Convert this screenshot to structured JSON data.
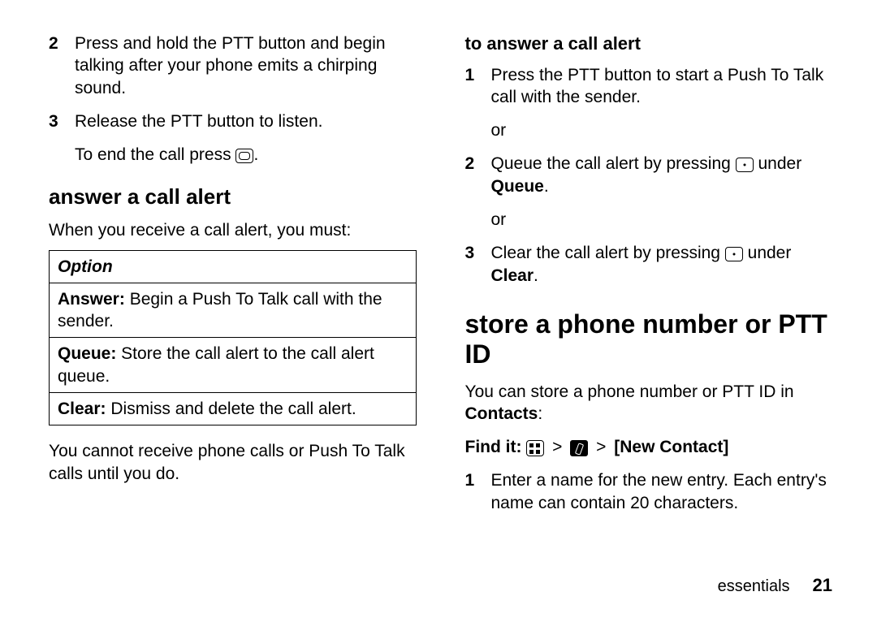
{
  "left": {
    "step2": {
      "num": "2",
      "text": "Press and hold the PTT button and begin talking after your phone emits a chirping sound."
    },
    "step3": {
      "num": "3",
      "text": "Release the PTT button to listen."
    },
    "endcall_pre": "To end the call press ",
    "endcall_post": ".",
    "heading": "answer a call alert",
    "intro": "When you receive a call alert, you must:",
    "table": {
      "header": "Option",
      "row1_label": "Answer:",
      "row1_text": " Begin a Push To Talk call with the sender.",
      "row2_label": "Queue:",
      "row2_text": " Store the call alert to the call alert queue.",
      "row3_label": "Clear:",
      "row3_text": " Dismiss and delete the call alert."
    },
    "note": "You cannot receive phone calls or Push To Talk calls until you do."
  },
  "right": {
    "heading_small": "to answer a call alert",
    "s1": {
      "num": "1",
      "text": "Press the PTT button to start a Push To Talk call with the sender."
    },
    "or": "or",
    "s2": {
      "num": "2",
      "pre": "Queue the call alert by pressing ",
      "post": " under ",
      "label": "Queue",
      "end": "."
    },
    "s3": {
      "num": "3",
      "pre": "Clear the call alert by pressing ",
      "post": " under ",
      "label": "Clear",
      "end": "."
    },
    "h1": "store a phone number or PTT ID",
    "storeintro_pre": "You can store a phone number or PTT ID in ",
    "storeintro_label": "Contacts",
    "storeintro_post": ":",
    "findit_label": "Find it:",
    "findit_gt": ">",
    "findit_new": "[New Contact]",
    "n1": {
      "num": "1",
      "text": "Enter a name for the new entry. Each entry's name can contain 20 characters."
    }
  },
  "footer": {
    "section": "essentials",
    "page": "21"
  }
}
